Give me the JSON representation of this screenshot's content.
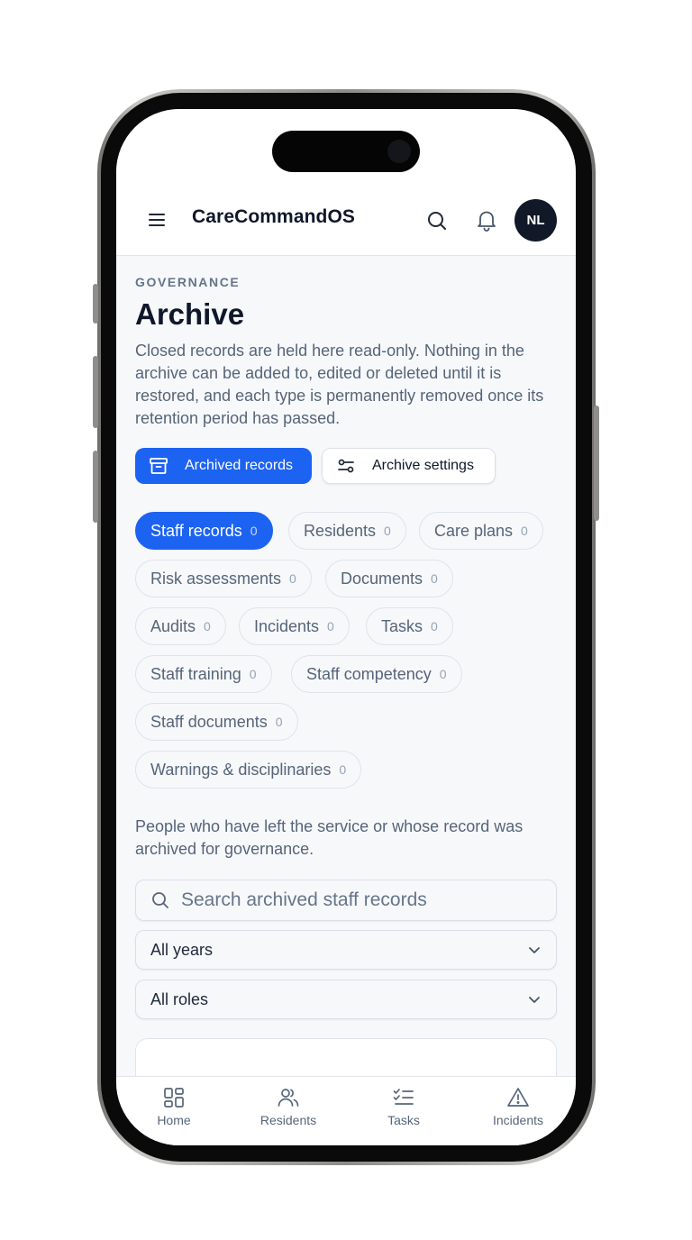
{
  "header": {
    "app_title": "CareCommandOS",
    "avatar_initials": "NL"
  },
  "page": {
    "eyebrow": "GOVERNANCE",
    "title": "Archive",
    "description": "Closed records are held here read-only. Nothing in the archive can be added to, edited or deleted until it is restored, and each type is permanently removed once its retention period has passed."
  },
  "segments": {
    "archived_records": "Archived records",
    "archive_settings": "Archive settings",
    "active": "archived_records"
  },
  "chips": [
    {
      "label": "Staff records",
      "count": "0",
      "active": true
    },
    {
      "label": "Residents",
      "count": "0",
      "active": false
    },
    {
      "label": "Care plans",
      "count": "0",
      "active": false
    },
    {
      "label": "Risk assessments",
      "count": "0",
      "active": false
    },
    {
      "label": "Documents",
      "count": "0",
      "active": false
    },
    {
      "label": "Audits",
      "count": "0",
      "active": false
    },
    {
      "label": "Incidents",
      "count": "0",
      "active": false
    },
    {
      "label": "Tasks",
      "count": "0",
      "active": false
    },
    {
      "label": "Staff training",
      "count": "0",
      "active": false
    },
    {
      "label": "Staff competency",
      "count": "0",
      "active": false
    },
    {
      "label": "Staff documents",
      "count": "0",
      "active": false
    },
    {
      "label": "Warnings & disciplinaries",
      "count": "0",
      "active": false
    }
  ],
  "section": {
    "info": "People who have left the service or whose record was archived for governance.",
    "search_placeholder": "Search archived staff records",
    "year_filter": "All years",
    "role_filter": "All roles"
  },
  "nav": {
    "home": "Home",
    "residents": "Residents",
    "tasks": "Tasks",
    "incidents": "Incidents"
  },
  "colors": {
    "accent": "#1d63f2",
    "text_primary": "#0f172a",
    "text_muted": "#56657a",
    "avatar_bg": "#111827"
  }
}
